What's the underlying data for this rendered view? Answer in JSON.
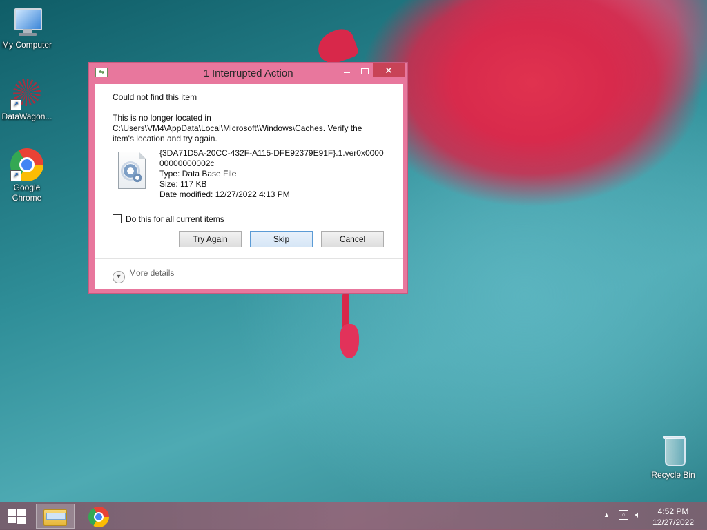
{
  "desktop": {
    "icons": [
      {
        "label": "My Computer"
      },
      {
        "label": "DataWagon..."
      },
      {
        "label": "Google Chrome"
      },
      {
        "label": "Recycle Bin"
      }
    ]
  },
  "dialog": {
    "title": "1 Interrupted Action",
    "heading": "Could not find this item",
    "description": "This is no longer located in C:\\Users\\VM4\\AppData\\Local\\Microsoft\\Windows\\Caches. Verify the item's location and try again.",
    "file": {
      "name": "{3DA71D5A-20CC-432F-A115-DFE92379E91F}.1.ver0x000000000000002c",
      "type": "Type: Data Base File",
      "size": "Size: 117 KB",
      "date_modified": "Date modified: 12/27/2022 4:13 PM"
    },
    "checkbox_label": "Do this for all current items",
    "buttons": {
      "try_again": "Try Again",
      "skip": "Skip",
      "cancel": "Cancel"
    },
    "more_details": "More details"
  },
  "taskbar": {
    "clock_time": "4:52 PM",
    "clock_date": "12/27/2022"
  }
}
